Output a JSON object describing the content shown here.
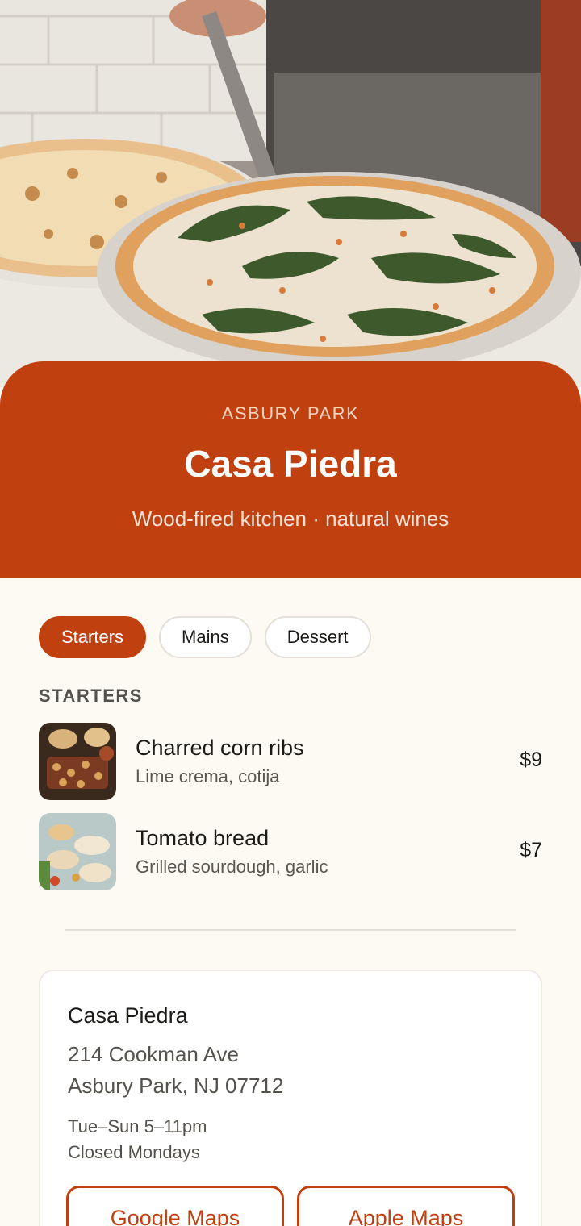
{
  "header": {
    "location": "ASBURY PARK",
    "name": "Casa Piedra",
    "tagline": "Wood-fired kitchen · natural wines"
  },
  "tabs": [
    {
      "label": "Starters",
      "active": true
    },
    {
      "label": "Mains",
      "active": false
    },
    {
      "label": "Dessert",
      "active": false
    }
  ],
  "section": {
    "label": "STARTERS"
  },
  "items": [
    {
      "name": "Charred corn ribs",
      "description": "Lime crema, cotija",
      "price": "$9"
    },
    {
      "name": "Tomato bread",
      "description": "Grilled sourdough, garlic",
      "price": "$7"
    }
  ],
  "info": {
    "name": "Casa Piedra",
    "address_line1": "214 Cookman Ave",
    "address_line2": "Asbury Park, NJ 07712",
    "hours_line1": "Tue–Sun 5–11pm",
    "hours_line2": "Closed Mondays",
    "google_maps_label": "Google Maps",
    "apple_maps_label": "Apple Maps"
  },
  "colors": {
    "accent": "#c1400f",
    "background": "#fdfaf4"
  }
}
